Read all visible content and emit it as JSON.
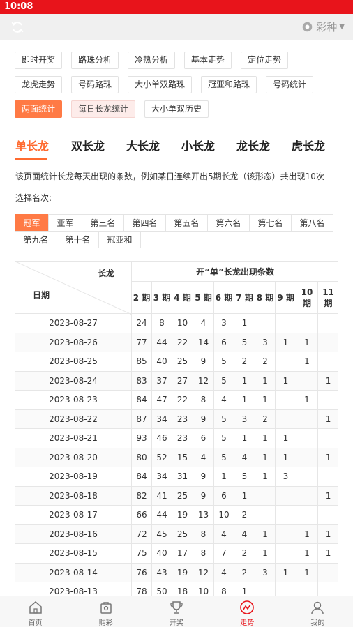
{
  "status": {
    "time": "10:08"
  },
  "appbar": {
    "lottery": "彩种"
  },
  "analysis_buttons": [
    [
      "即时开奖",
      "路珠分析",
      "冷热分析",
      "基本走势",
      "定位走势"
    ],
    [
      "龙虎走势",
      "号码路珠",
      "大小单双路珠",
      "冠亚和路珠",
      "号码统计"
    ],
    [
      "两面统计",
      "每日长龙统计",
      "大小单双历史"
    ]
  ],
  "tabs": [
    "单长龙",
    "双长龙",
    "大长龙",
    "小长龙",
    "龙长龙",
    "虎长龙"
  ],
  "description": "该页面统计长龙每天出现的条数，例如某日连续开出5期长龙（该形态）共出现10次",
  "choose_label": "选择名次:",
  "ranks": [
    [
      "冠军",
      "亚军",
      "第三名",
      "第四名",
      "第五名",
      "第六名",
      "第七名",
      "第八名"
    ],
    [
      "第九名",
      "第十名",
      "冠亚和"
    ]
  ],
  "table": {
    "corner_top": "长龙",
    "corner_bottom": "日期",
    "group_header": "开“单”长龙出现条数",
    "periods": [
      "2 期",
      "3 期",
      "4 期",
      "5 期",
      "6 期",
      "7 期",
      "8 期",
      "9 期",
      "10 期",
      "11 期"
    ],
    "rows": [
      [
        "2023-08-27",
        "24",
        "8",
        "10",
        "4",
        "3",
        "1",
        "",
        "",
        "",
        ""
      ],
      [
        "2023-08-26",
        "77",
        "44",
        "22",
        "14",
        "6",
        "5",
        "3",
        "1",
        "1",
        ""
      ],
      [
        "2023-08-25",
        "85",
        "40",
        "25",
        "9",
        "5",
        "2",
        "2",
        "",
        "1",
        ""
      ],
      [
        "2023-08-24",
        "83",
        "37",
        "27",
        "12",
        "5",
        "1",
        "1",
        "1",
        "",
        "1"
      ],
      [
        "2023-08-23",
        "84",
        "47",
        "22",
        "8",
        "4",
        "1",
        "1",
        "",
        "1",
        ""
      ],
      [
        "2023-08-22",
        "87",
        "34",
        "23",
        "9",
        "5",
        "3",
        "2",
        "",
        "",
        "1"
      ],
      [
        "2023-08-21",
        "93",
        "46",
        "23",
        "6",
        "5",
        "1",
        "1",
        "1",
        "",
        ""
      ],
      [
        "2023-08-20",
        "80",
        "52",
        "15",
        "4",
        "5",
        "4",
        "1",
        "1",
        "",
        "1"
      ],
      [
        "2023-08-19",
        "84",
        "34",
        "31",
        "9",
        "1",
        "5",
        "1",
        "3",
        "",
        ""
      ],
      [
        "2023-08-18",
        "82",
        "41",
        "25",
        "9",
        "6",
        "1",
        "",
        "",
        "",
        "1"
      ],
      [
        "2023-08-17",
        "66",
        "44",
        "19",
        "13",
        "10",
        "2",
        "",
        "",
        "",
        ""
      ],
      [
        "2023-08-16",
        "72",
        "45",
        "25",
        "8",
        "4",
        "4",
        "1",
        "",
        "1",
        "1"
      ],
      [
        "2023-08-15",
        "75",
        "40",
        "17",
        "8",
        "7",
        "2",
        "1",
        "",
        "1",
        "1"
      ],
      [
        "2023-08-14",
        "76",
        "43",
        "19",
        "12",
        "4",
        "2",
        "3",
        "1",
        "1",
        ""
      ],
      [
        "2023-08-13",
        "78",
        "50",
        "18",
        "10",
        "8",
        "1",
        "",
        "",
        "",
        ""
      ]
    ]
  },
  "bottom_nav": [
    {
      "label": "首页",
      "icon": "home-icon"
    },
    {
      "label": "购彩",
      "icon": "lottery-shop-icon"
    },
    {
      "label": "开奖",
      "icon": "trophy-icon"
    },
    {
      "label": "走势",
      "icon": "trend-chart-icon"
    },
    {
      "label": "我的",
      "icon": "user-icon"
    }
  ],
  "colors": {
    "statusbar": "#e8141b",
    "accent": "#ff6a2f",
    "active_chip": "#ff7a45",
    "nav_active": "#e8141b"
  }
}
